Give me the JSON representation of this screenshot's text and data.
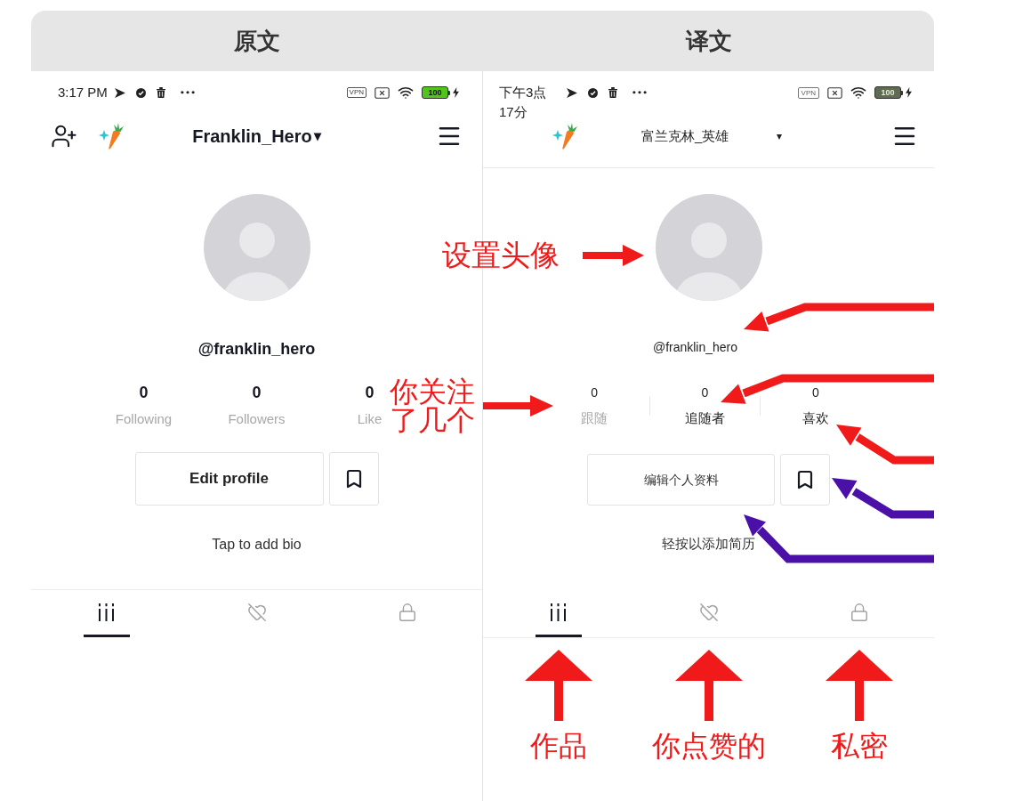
{
  "header": {
    "left_title": "原文",
    "right_title": "译文"
  },
  "original": {
    "status_bar": {
      "time": "3:17 PM",
      "vpn": "VPN",
      "battery": "100"
    },
    "top_bar": {
      "username": "Franklin_Hero",
      "caret": "▾"
    },
    "profile": {
      "handle": "@franklin_hero",
      "stats": [
        {
          "value": "0",
          "label": "Following",
          "dimmed": true
        },
        {
          "value": "0",
          "label": "Followers",
          "dimmed": true
        },
        {
          "value": "0",
          "label": "Like",
          "dimmed": true
        }
      ],
      "edit_button": "Edit profile",
      "bio_prompt": "Tap to add bio"
    },
    "tabs": [
      {
        "kind": "videos",
        "selected": true
      },
      {
        "kind": "liked",
        "selected": false
      },
      {
        "kind": "private",
        "selected": false
      }
    ]
  },
  "translation": {
    "status_bar": {
      "time_lines": [
        "下午3点",
        "17分"
      ],
      "vpn": "VPN",
      "battery": "100"
    },
    "top_bar": {
      "username": "富兰克林_英雄",
      "caret": "▾"
    },
    "profile": {
      "handle": "@franklin_hero",
      "stats": [
        {
          "value": "0",
          "label": "跟随",
          "dimmed": true
        },
        {
          "value": "0",
          "label": "追随者",
          "dimmed": false
        },
        {
          "value": "0",
          "label": "喜欢",
          "dimmed": false
        }
      ],
      "edit_button": "编辑个人资料",
      "bio_prompt": "轻按以添加简历"
    },
    "tabs": [
      {
        "kind": "videos",
        "selected": true
      },
      {
        "kind": "liked",
        "selected": false
      },
      {
        "kind": "private",
        "selected": false
      }
    ]
  },
  "annotations": {
    "avatar_note": "设置头像",
    "following_note": "你关注了几个",
    "tab_notes": [
      "作品",
      "你点赞的",
      "私密"
    ]
  }
}
